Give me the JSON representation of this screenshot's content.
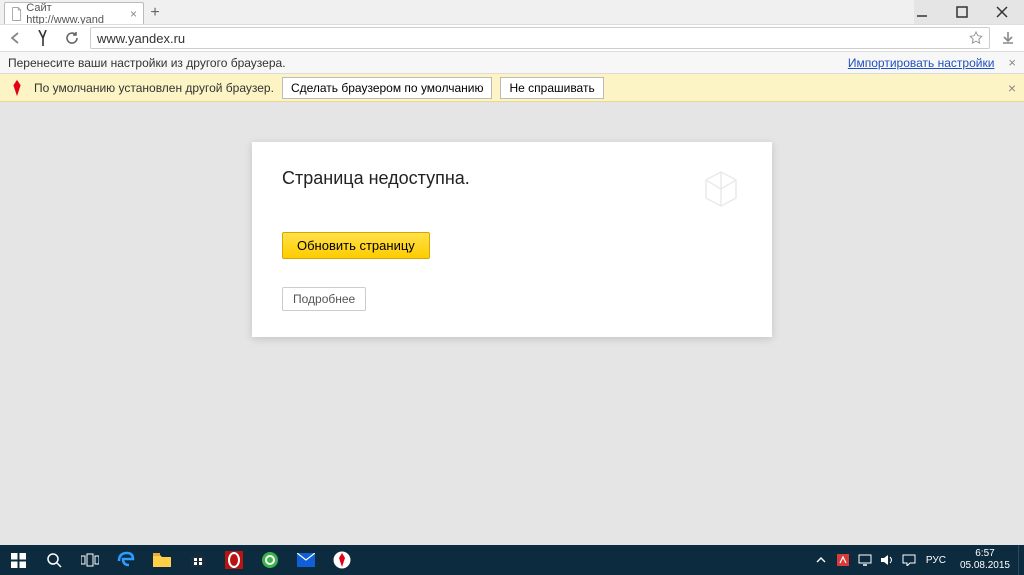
{
  "window": {
    "menu_icon": "menu-icon",
    "minimize_icon": "minimize-icon",
    "maximize_icon": "maximize-icon",
    "close_icon": "close-icon"
  },
  "tab": {
    "title": "Сайт http://www.yand",
    "close": "×"
  },
  "address": {
    "url": "www.yandex.ru"
  },
  "info_bar": {
    "text": "Перенесите ваши настройки из другого браузера.",
    "link": "Импортировать настройки"
  },
  "yellow_bar": {
    "text": "По умолчанию установлен другой браузер.",
    "btn_default": "Сделать браузером по умолчанию",
    "btn_dismiss": "Не спрашивать"
  },
  "card": {
    "title": "Страница недоступна.",
    "refresh": "Обновить страницу",
    "more": "Подробнее"
  },
  "taskbar": {
    "lang": "РУС",
    "time": "6:57",
    "date": "05.08.2015"
  }
}
